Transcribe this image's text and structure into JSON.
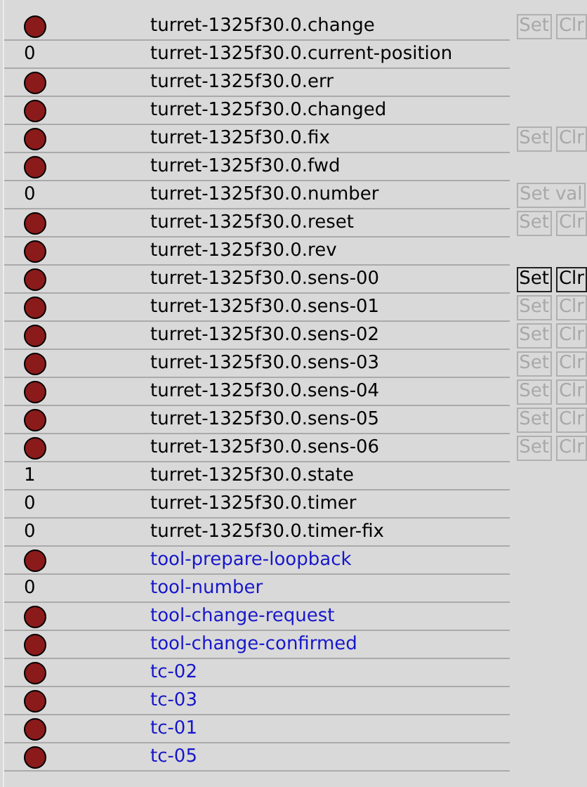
{
  "rows": [
    {
      "kind": "bit",
      "value": false,
      "name": "turret-1325f30.0.change",
      "signal": false,
      "buttons": [
        {
          "label": "Set",
          "disabled": true
        },
        {
          "label": "Clr",
          "disabled": true
        }
      ]
    },
    {
      "kind": "number",
      "value": "0",
      "name": "turret-1325f30.0.current-position",
      "signal": false
    },
    {
      "kind": "bit",
      "value": false,
      "name": "turret-1325f30.0.err",
      "signal": false
    },
    {
      "kind": "bit",
      "value": false,
      "name": "turret-1325f30.0.changed",
      "signal": false
    },
    {
      "kind": "bit",
      "value": false,
      "name": "turret-1325f30.0.fix",
      "signal": false,
      "buttons": [
        {
          "label": "Set",
          "disabled": true
        },
        {
          "label": "Clr",
          "disabled": true
        }
      ]
    },
    {
      "kind": "bit",
      "value": false,
      "name": "turret-1325f30.0.fwd",
      "signal": false
    },
    {
      "kind": "number",
      "value": "0",
      "name": "turret-1325f30.0.number",
      "signal": false,
      "buttons": [
        {
          "label": "Set val",
          "disabled": true
        }
      ]
    },
    {
      "kind": "bit",
      "value": false,
      "name": "turret-1325f30.0.reset",
      "signal": false,
      "buttons": [
        {
          "label": "Set",
          "disabled": true
        },
        {
          "label": "Clr",
          "disabled": true
        }
      ]
    },
    {
      "kind": "bit",
      "value": false,
      "name": "turret-1325f30.0.rev",
      "signal": false
    },
    {
      "kind": "bit",
      "value": false,
      "name": "turret-1325f30.0.sens-00",
      "signal": false,
      "buttons": [
        {
          "label": "Set",
          "disabled": false
        },
        {
          "label": "Clr",
          "disabled": false
        }
      ]
    },
    {
      "kind": "bit",
      "value": false,
      "name": "turret-1325f30.0.sens-01",
      "signal": false,
      "buttons": [
        {
          "label": "Set",
          "disabled": true
        },
        {
          "label": "Clr",
          "disabled": true
        }
      ]
    },
    {
      "kind": "bit",
      "value": false,
      "name": "turret-1325f30.0.sens-02",
      "signal": false,
      "buttons": [
        {
          "label": "Set",
          "disabled": true
        },
        {
          "label": "Clr",
          "disabled": true
        }
      ]
    },
    {
      "kind": "bit",
      "value": false,
      "name": "turret-1325f30.0.sens-03",
      "signal": false,
      "buttons": [
        {
          "label": "Set",
          "disabled": true
        },
        {
          "label": "Clr",
          "disabled": true
        }
      ]
    },
    {
      "kind": "bit",
      "value": false,
      "name": "turret-1325f30.0.sens-04",
      "signal": false,
      "buttons": [
        {
          "label": "Set",
          "disabled": true
        },
        {
          "label": "Clr",
          "disabled": true
        }
      ]
    },
    {
      "kind": "bit",
      "value": false,
      "name": "turret-1325f30.0.sens-05",
      "signal": false,
      "buttons": [
        {
          "label": "Set",
          "disabled": true
        },
        {
          "label": "Clr",
          "disabled": true
        }
      ]
    },
    {
      "kind": "bit",
      "value": false,
      "name": "turret-1325f30.0.sens-06",
      "signal": false,
      "buttons": [
        {
          "label": "Set",
          "disabled": true
        },
        {
          "label": "Clr",
          "disabled": true
        }
      ]
    },
    {
      "kind": "number",
      "value": "1",
      "name": "turret-1325f30.0.state",
      "signal": false
    },
    {
      "kind": "number",
      "value": "0",
      "name": "turret-1325f30.0.timer",
      "signal": false
    },
    {
      "kind": "number",
      "value": "0",
      "name": "turret-1325f30.0.timer-fix",
      "signal": false
    },
    {
      "kind": "bit",
      "value": false,
      "name": "tool-prepare-loopback",
      "signal": true
    },
    {
      "kind": "number",
      "value": "0",
      "name": "tool-number",
      "signal": true
    },
    {
      "kind": "bit",
      "value": false,
      "name": "tool-change-request",
      "signal": true
    },
    {
      "kind": "bit",
      "value": false,
      "name": "tool-change-confirmed",
      "signal": true
    },
    {
      "kind": "bit",
      "value": false,
      "name": "tc-02",
      "signal": true
    },
    {
      "kind": "bit",
      "value": false,
      "name": "tc-03",
      "signal": true
    },
    {
      "kind": "bit",
      "value": false,
      "name": "tc-01",
      "signal": true
    },
    {
      "kind": "bit",
      "value": false,
      "name": "tc-05",
      "signal": true
    }
  ]
}
